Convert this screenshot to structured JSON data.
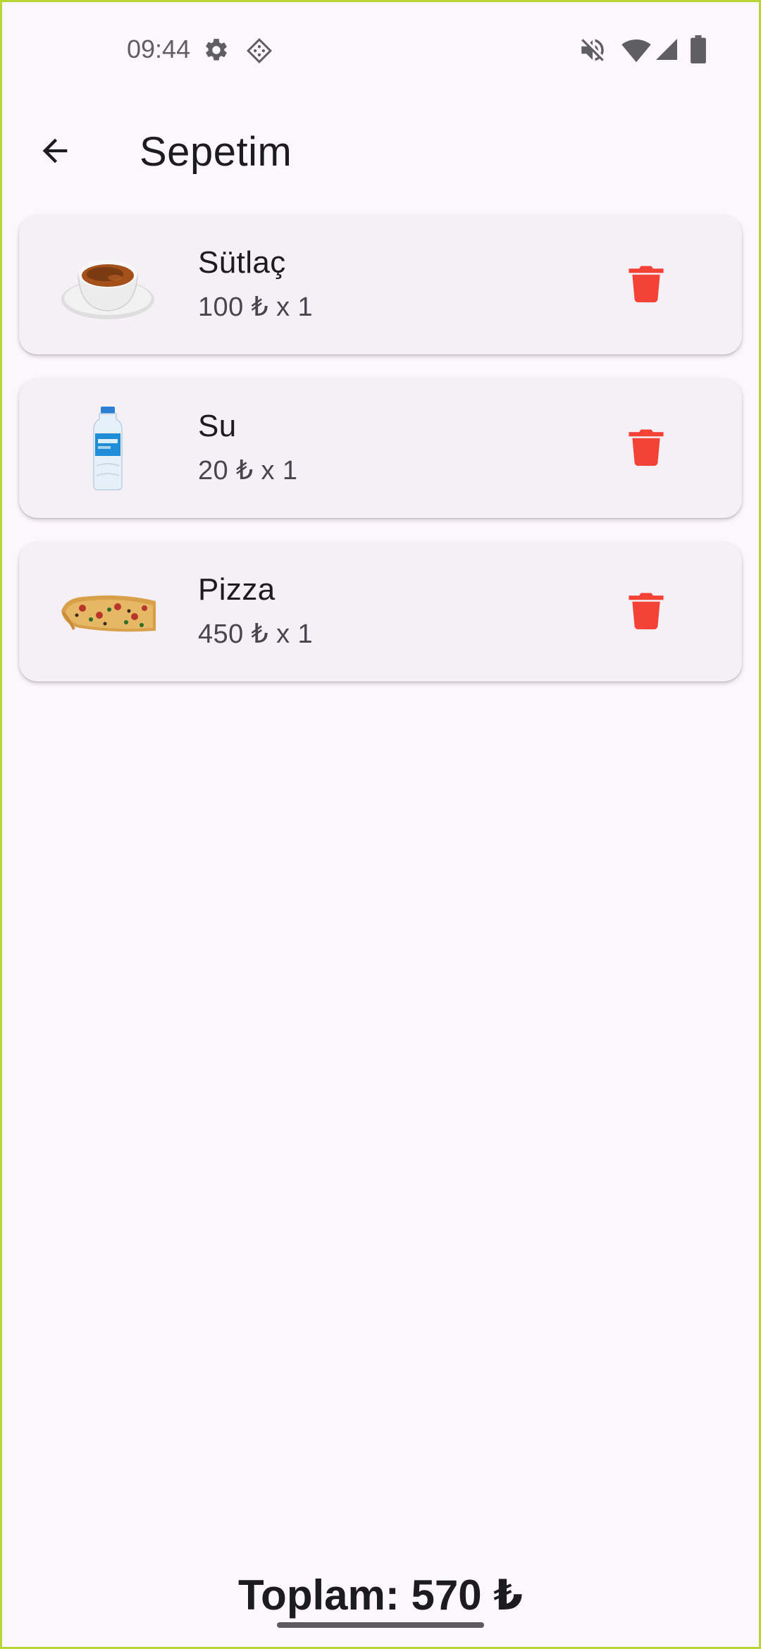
{
  "status_bar": {
    "time": "09:44",
    "icons": [
      "gear-icon",
      "diamond-app-icon",
      "mute-icon",
      "wifi-icon",
      "cell-signal-icon",
      "battery-icon"
    ]
  },
  "app_bar": {
    "title": "Sepetim",
    "back_icon": "arrow-left-icon"
  },
  "cart": {
    "items": [
      {
        "name": "Sütlaç",
        "price_line": "100 ₺ x 1",
        "image": "sutlac-bowl"
      },
      {
        "name": "Su",
        "price_line": "20 ₺ x 1",
        "image": "water-bottle"
      },
      {
        "name": "Pizza",
        "price_line": "450 ₺ x 1",
        "image": "pizza-slice"
      }
    ],
    "delete_icon": "trash-icon"
  },
  "total": {
    "text": "Toplam: 570 ₺"
  },
  "colors": {
    "background": "#fcf7fc",
    "card": "#f5eff6",
    "delete": "#f44336",
    "text": "#1c1b1f",
    "secondary_text": "#49454f"
  }
}
